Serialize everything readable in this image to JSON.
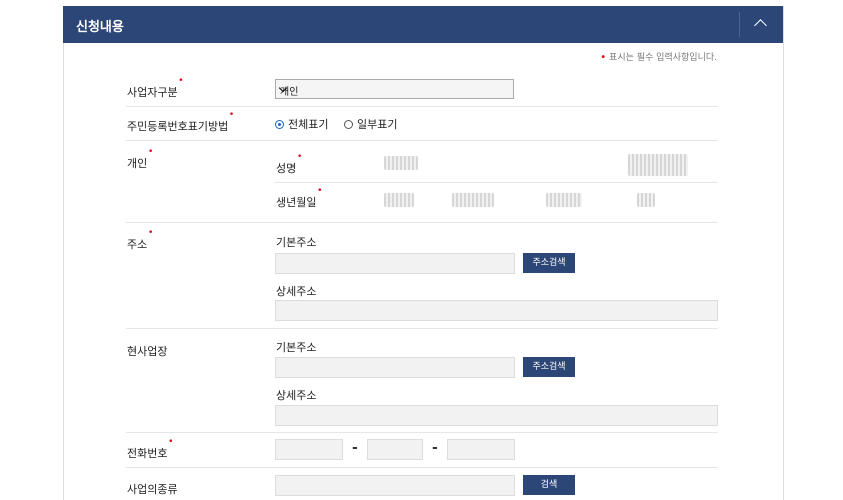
{
  "header": {
    "title": "신청내용"
  },
  "required_note": {
    "mark": "•",
    "text": "표시는 필수 입력사항입니다."
  },
  "fields": {
    "business_type": {
      "label": "사업자구분",
      "selected": "개인"
    },
    "id_display": {
      "label": "주민등록번호표기방법",
      "option_full": "전체표기",
      "option_partial": "일부표기",
      "selected": "전체표기"
    },
    "individual": {
      "label": "개인",
      "name_label": "성명",
      "birth_label": "생년월일"
    },
    "address": {
      "label": "주소",
      "basic_label": "기본주소",
      "search_button": "주소검색",
      "detail_label": "상세주소"
    },
    "workplace": {
      "label": "현사업장",
      "basic_label": "기본주소",
      "search_button": "주소검색",
      "detail_label": "상세주소"
    },
    "phone": {
      "label": "전화번호",
      "separator": "-"
    },
    "business_category": {
      "label": "사업의종류",
      "search_button": "검색"
    }
  },
  "colors": {
    "header_bg": "#2c4777",
    "button_bg": "#2c4777",
    "required_mark": "#e60012"
  },
  "icons": {
    "collapse": "chevron-up-icon",
    "select_arrow": "chevron-down-icon"
  }
}
